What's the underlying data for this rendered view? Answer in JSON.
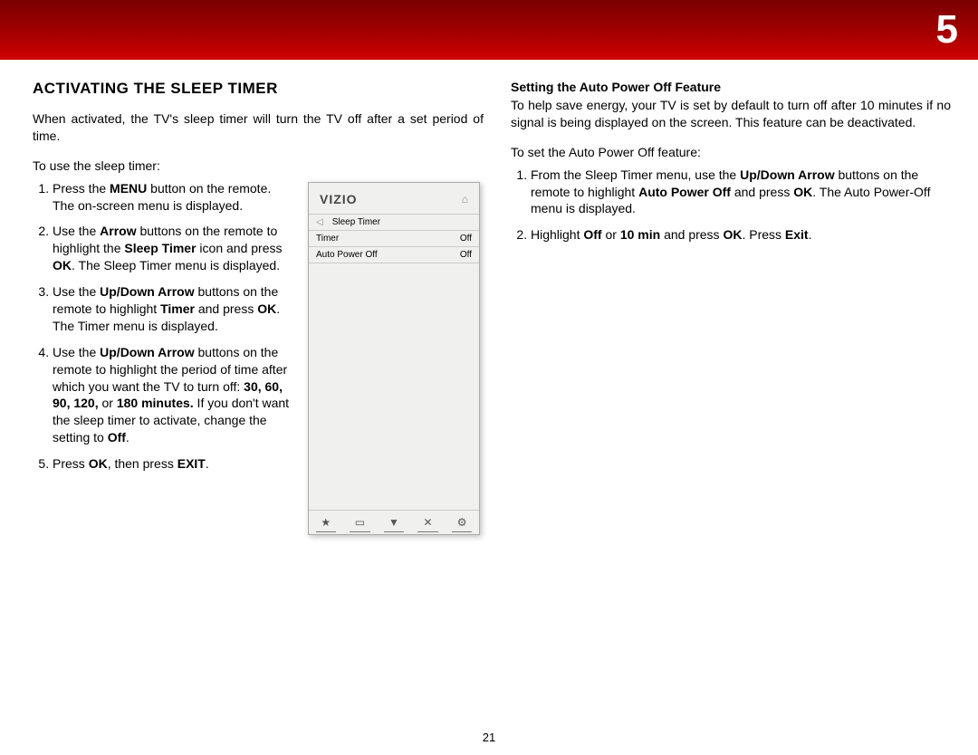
{
  "chapter": "5",
  "page_number": "21",
  "left": {
    "title": "ACTIVATING THE SLEEP TIMER",
    "intro": "When activated, the TV's sleep timer will turn the TV off after a set period of time.",
    "lead": "To use the sleep timer:",
    "step1_a": "Press the ",
    "step1_b": "MENU",
    "step1_c": " button on the remote. The on-screen menu is displayed.",
    "step2_a": "Use the ",
    "step2_b": "Arrow",
    "step2_c": " buttons on the remote to highlight the ",
    "step2_d": "Sleep Timer",
    "step2_e": " icon and press ",
    "step2_f": "OK",
    "step2_g": ". The Sleep Timer menu is displayed.",
    "step3_a": "Use the ",
    "step3_b": "Up/Down Arrow",
    "step3_c": " buttons on the remote to highlight ",
    "step3_d": "Timer",
    "step3_e": " and press ",
    "step3_f": "OK",
    "step3_g": ". The Timer menu is displayed.",
    "step4_a": "Use the ",
    "step4_b": "Up/Down Arrow",
    "step4_c": " buttons on the remote to highlight the period of time after which you want the TV to turn off: ",
    "step4_d": "30, 60, 90, 120,",
    "step4_e": " or ",
    "step4_f": "180 minutes.",
    "step4_g": " If you don't want the sleep timer to activate, change the setting to ",
    "step4_h": "Off",
    "step4_i": ".",
    "step5_a": "Press ",
    "step5_b": "OK",
    "step5_c": ", then press ",
    "step5_d": "EXIT",
    "step5_e": "."
  },
  "tv_menu": {
    "logo": "VIZIO",
    "menu_title": "Sleep Timer",
    "row1_label": "Timer",
    "row1_value": "Off",
    "row2_label": "Auto Power Off",
    "row2_value": "Off"
  },
  "right": {
    "heading": "Setting the Auto Power Off Feature",
    "intro": "To help save energy, your TV is set by default to turn off after 10 minutes if no signal is being displayed on the screen. This feature can be deactivated.",
    "lead": "To set the Auto Power Off feature:",
    "step1_a": "From the Sleep Timer menu, use the ",
    "step1_b": "Up/Down Arrow",
    "step1_c": " buttons on the remote to highlight ",
    "step1_d": "Auto Power Off",
    "step1_e": " and press ",
    "step1_f": "OK",
    "step1_g": ". The Auto Power-Off menu is displayed.",
    "step2_a": "Highlight ",
    "step2_b": "Off",
    "step2_c": " or ",
    "step2_d": "10 min",
    "step2_e": " and press ",
    "step2_f": "OK",
    "step2_g": ". Press ",
    "step2_h": "Exit",
    "step2_i": "."
  }
}
